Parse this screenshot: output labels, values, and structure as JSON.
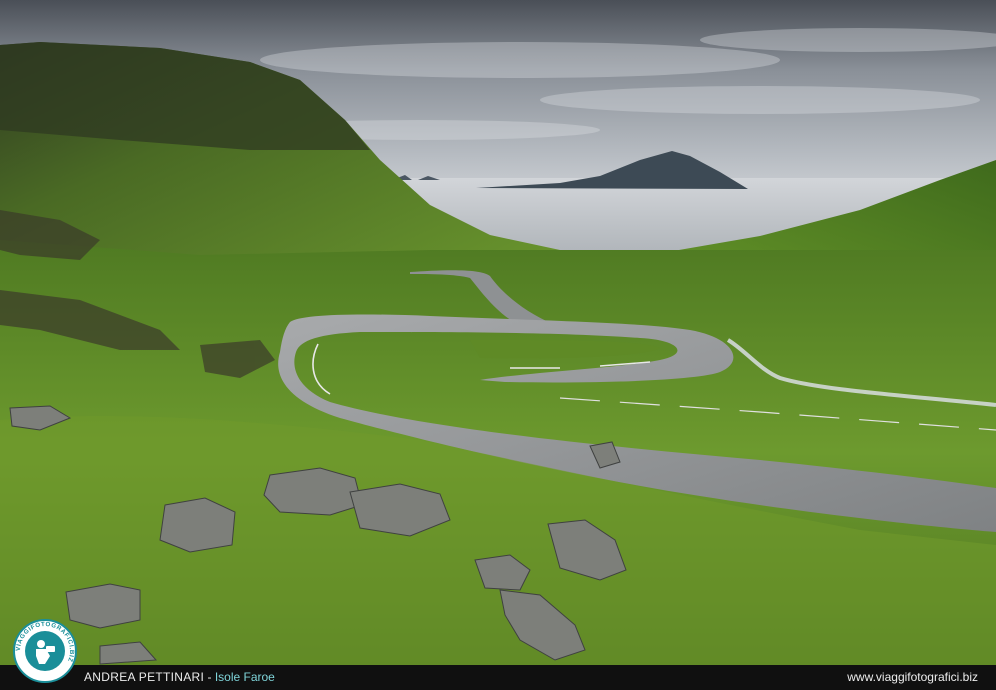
{
  "footer": {
    "author": "ANDREA PETTINARI",
    "separator": " - ",
    "location": "Isole Faroe",
    "website": "www.viaggifotografici.biz"
  },
  "logo": {
    "ring_text": "VIAGGIFOTOGRAFICI.BIZ",
    "icon": "photographer-camera-icon",
    "color": "#1a8e99"
  },
  "photo": {
    "subject": "winding mountain road",
    "colors": {
      "grass": "#6f9a2c",
      "road": "#8d8f91",
      "sky": "#9ea5ad",
      "sea": "#c9ccd0"
    }
  }
}
